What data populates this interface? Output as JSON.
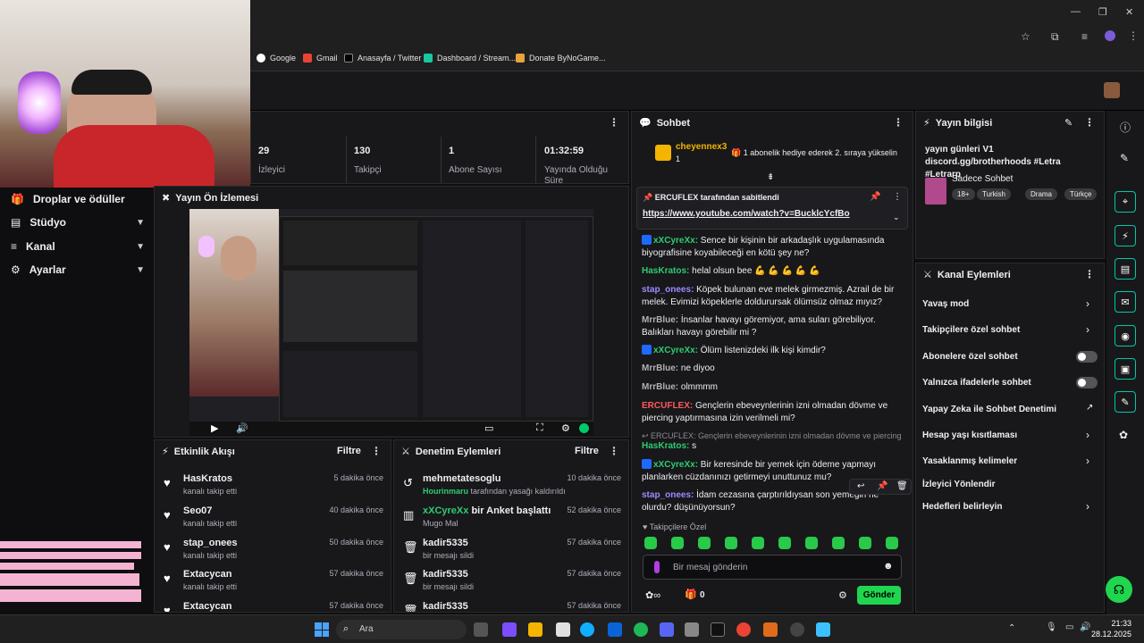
{
  "browser": {
    "bookmarks": [
      "Google",
      "Gmail",
      "Anasayfa / Twitter",
      "Dashboard / Stream...",
      "Donate ByNoGame..."
    ],
    "window_buttons": [
      "—",
      "❐",
      "✕"
    ]
  },
  "nav": {
    "items": [
      {
        "label": "Droplar ve ödüller"
      },
      {
        "label": "Stüdyo"
      },
      {
        "label": "Kanal"
      },
      {
        "label": "Ayarlar"
      }
    ]
  },
  "stats": {
    "viewers": {
      "value": "29",
      "label": "İzleyici"
    },
    "followers": {
      "value": "130",
      "label": "Takipçi"
    },
    "subs": {
      "value": "1",
      "label": "Abone Sayısı"
    },
    "uptime": {
      "value": "01:32:59",
      "label": "Yayında Olduğu Süre"
    }
  },
  "preview": {
    "title": "Yayın Ön İzlemesi"
  },
  "activity": {
    "title": "Etkinlik Akışı",
    "filter": "Filtre",
    "rows": [
      {
        "name": "HasKratos",
        "action": "kanalı takip etti",
        "time": "5 dakika önce"
      },
      {
        "name": "Seo07",
        "action": "kanalı takip etti",
        "time": "40 dakika önce"
      },
      {
        "name": "stap_onees",
        "action": "kanalı takip etti",
        "time": "50 dakika önce"
      },
      {
        "name": "Extacycan",
        "action": "kanalı takip etti",
        "time": "57 dakika önce"
      },
      {
        "name": "Extacycan",
        "action": "",
        "time": "57 dakika önce"
      }
    ]
  },
  "moderation": {
    "title": "Denetim Eylemleri",
    "filter": "Filtre",
    "rows": [
      {
        "name": "mehmetatesoglu",
        "name2": "Hourinmaru",
        "action": "tarafından yasağı kaldırıldı",
        "time": "10 dakika önce"
      },
      {
        "name": "xXCyreXx",
        "name2": "bir Anket başlattı",
        "action": "Mugo Mal",
        "time": "52 dakika önce"
      },
      {
        "name": "kadir5335",
        "name2": "",
        "action": "bir mesajı sildi",
        "time": "57 dakika önce"
      },
      {
        "name": "kadir5335",
        "name2": "",
        "action": "bir mesajı sildi",
        "time": "57 dakika önce"
      },
      {
        "name": "kadir5335",
        "name2": "",
        "action": "",
        "time": "57 dakika önce"
      }
    ]
  },
  "chat": {
    "title": "Sohbet",
    "gift_user": "cheyennex3",
    "gift_count": "1",
    "gift_text": "1 abonelik hediye ederek 2. sıraya yükselin",
    "pinned_by": "ERCUFLEX",
    "pinned_suffix": "tarafından sabitlendi",
    "pinned_link": "https://www.youtube.com/watch?v=BucklcYcfBo",
    "messages": [
      {
        "user": "xXCyreXx:",
        "color": "#2ecc71",
        "text": " Sence bir kişinin bir arkadaşlık uygulamasında biyografisine koyabileceği en kötü şey ne?"
      },
      {
        "user": "HasKratos:",
        "color": "#2ecc71",
        "text": " helal olsun bee 💪 💪 💪 💪 💪"
      },
      {
        "user": "stap_onees:",
        "color": "#9b8cff",
        "text": " Köpek bulunan eve melek girmezmiş. Azrail de bir melek. Evimizi köpeklerle doldurursak ölümsüz olmaz mıyız?"
      },
      {
        "user": "MrrBlue:",
        "color": "#b2b2b2",
        "text": " İnsanlar havayı göremiyor, ama suları görebiliyor. Balıkları havayı görebilir mi ?"
      },
      {
        "user": "xXCyreXx:",
        "color": "#2ecc71",
        "text": " Ölüm listenizdeki ilk kişi kimdir?"
      },
      {
        "user": "MrrBlue:",
        "color": "#b2b2b2",
        "text": " ne diyoo"
      },
      {
        "user": "MrrBlue:",
        "color": "#b2b2b2",
        "text": " olmmmm"
      },
      {
        "user": "ERCUFLEX:",
        "color": "#ff5a5a",
        "text": " Gençlerin ebeveynlerinin izni olmadan dövme ve piercing yaptırmasına izin verilmeli mi?"
      },
      {
        "user": "HasKratos:",
        "color": "#2ecc71",
        "text": " s"
      },
      {
        "user": "xXCyreXx:",
        "color": "#2ecc71",
        "text": " Bir keresinde bir yemek için ödeme yapmayı planlarken cüzdanınızı getirmeyi unuttunuz mu?"
      },
      {
        "user": "stap_onees:",
        "color": "#9b8cff",
        "text": " İdam cezasına çarptırıldıysan son yemeğin ne olurdu? düşünüyorsun?"
      }
    ],
    "reply_text": "↩ ERCUFLEX: Gençlerin ebeveynlerinin izni olmadan dövme ve piercing ...",
    "followers_only": "Takipçilere Özel",
    "input_placeholder": "Bir mesaj gönderin",
    "points": "0",
    "send": "Gönder"
  },
  "stream_info": {
    "title": "Yayın bilgisi",
    "text": "yayın günleri V1 discord.gg/brotherhoods #Letra #Letrarp",
    "category": "Sadece Sohbet",
    "tags": [
      "18+",
      "Turkish",
      "Drama",
      "Türkçe"
    ]
  },
  "channel_actions": {
    "title": "Kanal Eylemleri",
    "items": [
      {
        "label": "Yavaş mod",
        "kind": "chev"
      },
      {
        "label": "Takipçilere özel sohbet",
        "kind": "chev"
      },
      {
        "label": "Abonelere özel sohbet",
        "kind": "toggle"
      },
      {
        "label": "Yalnızca ifadelerle sohbet",
        "kind": "toggle"
      },
      {
        "label": "Yapay Zeka ile Sohbet Denetimi",
        "kind": "ext"
      },
      {
        "label": "Hesap yaşı kısıtlaması",
        "kind": "chev"
      },
      {
        "label": "Yasaklanmış kelimeler",
        "kind": "chev"
      },
      {
        "label": "İzleyici Yönlendir",
        "kind": "none"
      },
      {
        "label": "Hedefleri belirleyin",
        "kind": "chev"
      }
    ]
  },
  "taskbar": {
    "search": "Ara",
    "time": "21:33",
    "date": "28.12.2025"
  }
}
